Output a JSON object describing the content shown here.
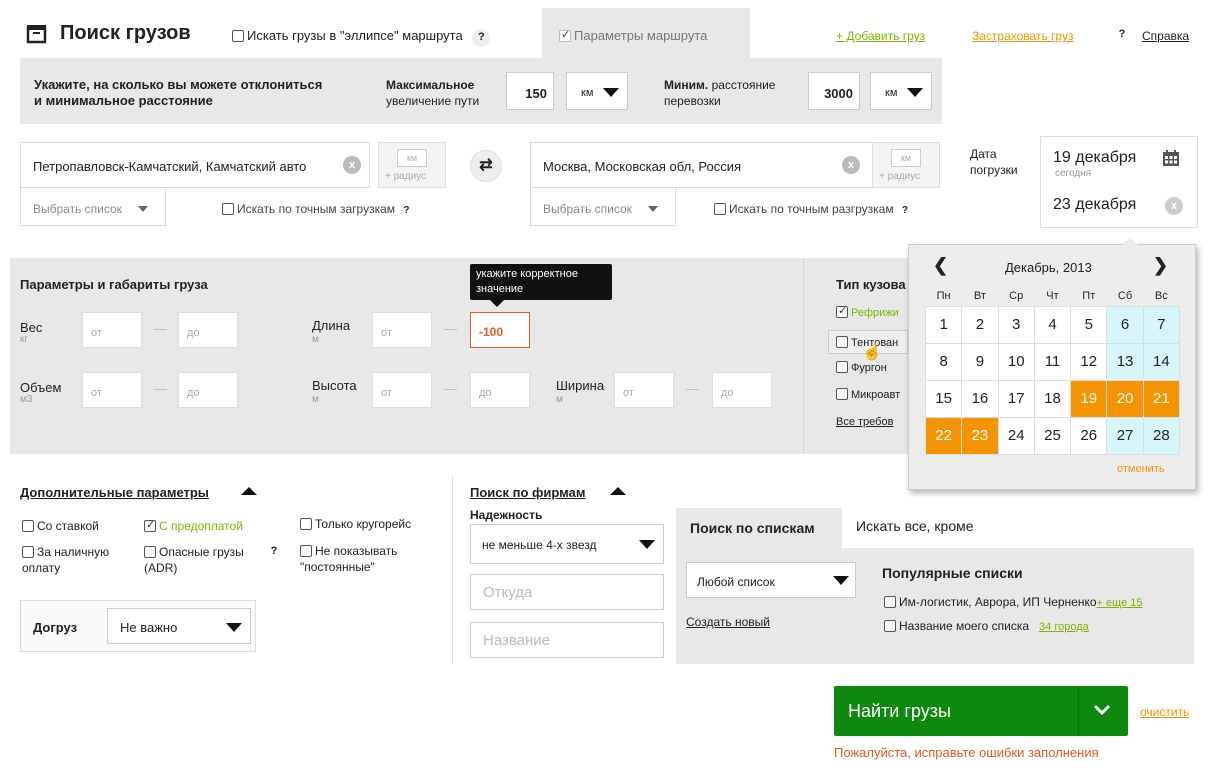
{
  "header": {
    "title": "Поиск грузов",
    "ellipse_label": "Искать грузы в \"эллипсе\" маршрута",
    "route_params_tab": "Параметры маршрута",
    "add_cargo": "+ Добавить груз",
    "insure": "Застраховать груз",
    "help": "Справка",
    "q": "?"
  },
  "deviation": {
    "label": "Укажите, на сколько вы можете отклониться и минимальное расстояние",
    "max_label_bold": "Максимальное",
    "max_label_rest": "увеличение пути",
    "max_value": "150",
    "max_unit": "км",
    "min_label_bold": "Миним.",
    "min_label_rest": "расстояние перевозки",
    "min_value": "3000",
    "min_unit": "км"
  },
  "from": {
    "value": "Петропавловск-Камчатский, Камчатский авто",
    "km": "км",
    "radius": "+ радиус",
    "list": "Выбрать список",
    "exact": "Искать по точным загрузкам"
  },
  "to": {
    "value": "Москва, Московская обл, Россия",
    "km": "км",
    "radius": "+ радиус",
    "list": "Выбрать список",
    "exact": "Искать по точным разгрузкам"
  },
  "date": {
    "label": "Дата погрузки",
    "from": "19 декабря",
    "today": "сегодня",
    "to": "23 декабря"
  },
  "cargo": {
    "title": "Параметры и габариты груза",
    "weight": "Вес",
    "weight_unit": "кг",
    "volume": "Объем",
    "volume_unit": "м3",
    "length": "Длина",
    "height": "Высота",
    "width": "Ширина",
    "m": "м",
    "from_ph": "от",
    "to_ph": "до",
    "length_to": "-100",
    "tooltip": "укажите корректное значение"
  },
  "body": {
    "title": "Тип кузова",
    "items": [
      "Рефрижи",
      "Тентован",
      "Фургон",
      "Микроавт"
    ],
    "all": "Все требов"
  },
  "calendar": {
    "month": "Декабрь, 2013",
    "days": [
      "Пн",
      "Вт",
      "Ср",
      "Чт",
      "Пт",
      "Сб",
      "Вс"
    ],
    "weeks": [
      [
        "1",
        "2",
        "3",
        "4",
        "5",
        "6",
        "7"
      ],
      [
        "8",
        "9",
        "10",
        "11",
        "12",
        "13",
        "14"
      ],
      [
        "15",
        "16",
        "17",
        "18",
        "19",
        "20",
        "21"
      ],
      [
        "22",
        "23",
        "24",
        "25",
        "26",
        "27",
        "28"
      ]
    ],
    "cancel": "отменить"
  },
  "extra": {
    "title": "Дополнительные параметры",
    "rate": "Со ставкой",
    "prepay": "С предоплатой",
    "round": "Только кругорейс",
    "cash": "За наличную оплату",
    "adr": "Опасные грузы (ADR)",
    "not_show": "Не показывать \"постоянные\"",
    "dogruz": "Догруз",
    "dogruz_value": "Не важно"
  },
  "firms": {
    "title": "Поиск по фирмам",
    "reliability": "Надежность",
    "reliability_value": "не меньше 4-х звезд",
    "from_ph": "Откуда",
    "name_ph": "Название"
  },
  "lists": {
    "tab_active": "Поиск по спискам",
    "tab2": "Искать все, кроме",
    "any": "Любой список",
    "create": "Создать новый",
    "popular": "Популярные списки",
    "item1": "Им-логистик, Аврора, ИП Черненко",
    "item1_more": "+ еще 15",
    "item2": "Название моего списка",
    "item2_more": "34 города"
  },
  "actions": {
    "search": "Найти грузы",
    "clear": "очистить",
    "error": "Пожалуйста, исправьте ошибки заполнения"
  },
  "colors": {
    "green": "#0d8a0d",
    "orange": "#f39400",
    "weekend": "#d7f6fb",
    "link_green": "#7cb500"
  }
}
